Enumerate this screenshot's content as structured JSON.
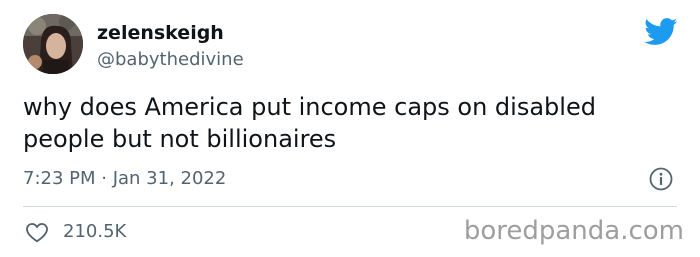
{
  "tweet": {
    "display_name": "zelenskeigh",
    "handle": "@babythedivine",
    "text": "why does America put income caps on disabled people but not billionaires",
    "timestamp": "7:23 PM · Jan 31, 2022",
    "likes": "210.5K"
  },
  "icons": {
    "brand": "twitter-bird-icon",
    "info": "info-icon",
    "like": "heart-icon"
  },
  "colors": {
    "brand_blue": "#1d9bf0",
    "text_primary": "#0f1419",
    "text_secondary": "#536471",
    "divider": "#cfd9de",
    "watermark": "#9e9e9e"
  },
  "watermark": {
    "text": "boredpanda.com"
  }
}
